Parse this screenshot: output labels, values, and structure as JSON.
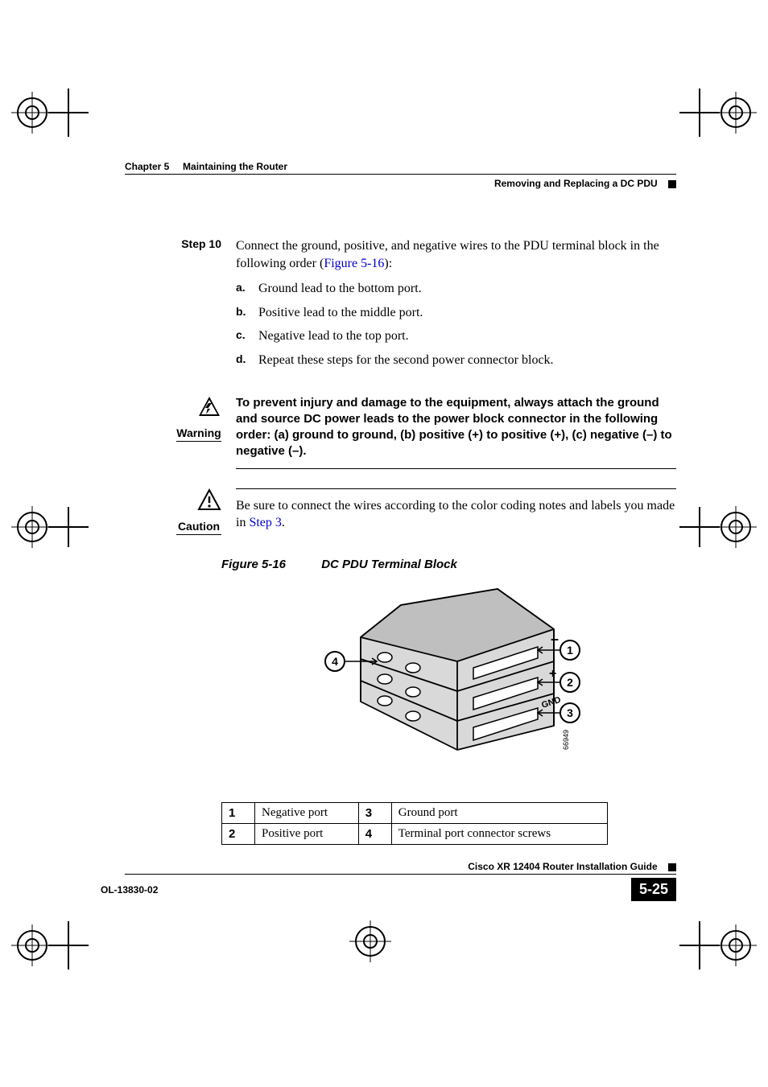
{
  "header": {
    "chapter_label": "Chapter 5",
    "chapter_title": "Maintaining the Router",
    "section_title": "Removing and Replacing a DC PDU"
  },
  "step": {
    "label": "Step 10",
    "text_before_link": "Connect the ground, positive, and negative wires to the PDU terminal block in the following order (",
    "figure_link": "Figure 5-16",
    "text_after_link": "):",
    "items": [
      {
        "lbl": "a.",
        "txt": "Ground lead to the bottom port."
      },
      {
        "lbl": "b.",
        "txt": "Positive lead to the middle port."
      },
      {
        "lbl": "c.",
        "txt": "Negative lead to the top port."
      },
      {
        "lbl": "d.",
        "txt": "Repeat these steps for the second power connector block."
      }
    ]
  },
  "warning": {
    "label": "Warning",
    "text": "To prevent injury and damage to the equipment, always attach the ground and source DC power leads to the power block connector in the following order: (a) ground to ground, (b) positive (+) to positive (+), (c) negative (–) to negative (–)."
  },
  "caution": {
    "label": "Caution",
    "text_before_link": "Be sure to connect the wires according to the color coding notes and labels you made in ",
    "step_link": "Step 3",
    "text_after_link": "."
  },
  "figure": {
    "number": "Figure 5-16",
    "title": "DC PDU Terminal Block",
    "image_id": "66949",
    "callouts": {
      "1": {
        "symbol": "–"
      },
      "2": {
        "symbol": "+"
      },
      "3": {
        "label": "GND"
      },
      "4": {}
    }
  },
  "legend": [
    {
      "num": "1",
      "desc": "Negative port"
    },
    {
      "num": "2",
      "desc": "Positive port"
    },
    {
      "num": "3",
      "desc": "Ground port"
    },
    {
      "num": "4",
      "desc": "Terminal port connector screws"
    }
  ],
  "footer": {
    "guide_title": "Cisco XR 12404 Router Installation Guide",
    "doc_id": "OL-13830-02",
    "page_number": "5-25"
  }
}
